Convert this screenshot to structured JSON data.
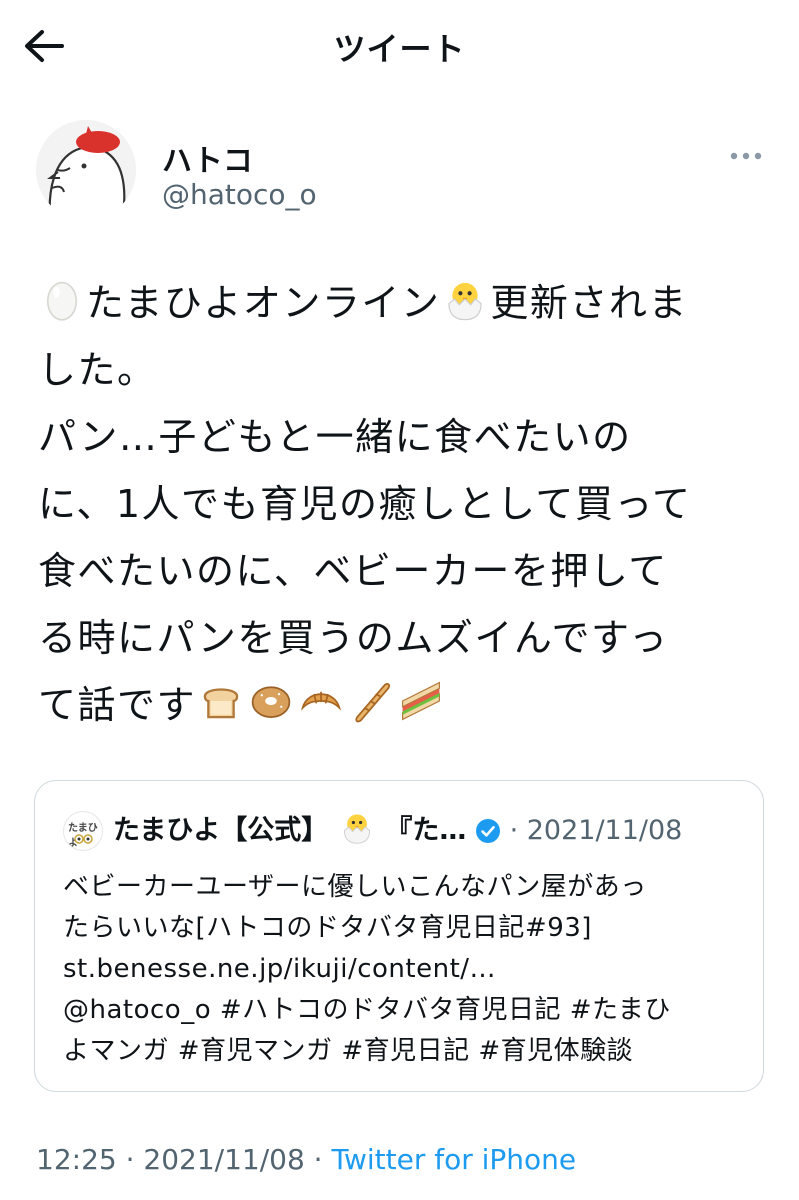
{
  "header": {
    "title": "ツイート",
    "back_icon": "arrow-left-icon"
  },
  "author": {
    "name": "ハトコ",
    "handle": "@hatoco_o",
    "more_icon": "ellipsis-icon"
  },
  "tweet": {
    "lines": [
      {
        "segments": [
          {
            "type": "emoji",
            "name": "egg-icon"
          },
          {
            "type": "text",
            "text": "たまひよオンライン"
          },
          {
            "type": "emoji",
            "name": "hatching-chick-icon"
          },
          {
            "type": "text",
            "text": "更新されま"
          }
        ]
      },
      {
        "segments": [
          {
            "type": "text",
            "text": "した。"
          }
        ]
      },
      {
        "segments": [
          {
            "type": "text",
            "text": "パン…子どもと一緒に食べたいの"
          }
        ]
      },
      {
        "segments": [
          {
            "type": "text",
            "text": "に、1人でも育児の癒しとして買って"
          }
        ]
      },
      {
        "segments": [
          {
            "type": "text",
            "text": "食べたいのに、ベビーカーを押して"
          }
        ]
      },
      {
        "segments": [
          {
            "type": "text",
            "text": "る時にパンを買うのムズイんですっ"
          }
        ]
      },
      {
        "segments": [
          {
            "type": "text",
            "text": "て話です"
          },
          {
            "type": "emoji",
            "name": "bread-icon"
          },
          {
            "type": "emoji",
            "name": "bagel-icon"
          },
          {
            "type": "emoji",
            "name": "croissant-icon"
          },
          {
            "type": "emoji",
            "name": "baguette-icon"
          },
          {
            "type": "emoji",
            "name": "sandwich-icon"
          }
        ]
      }
    ]
  },
  "quoted": {
    "avatar_text": "たまひよ",
    "name": "たまひよ【公式】",
    "name_rest": "『た…",
    "date": "· 2021/11/08",
    "lines": [
      "ベビーカーユーザーに優しいこんなパン屋があっ",
      "たらいいな[ハトコのドタバタ育児日記#93]",
      "st.benesse.ne.jp/ikuji/content/…",
      "@hatoco_o #ハトコのドタバタ育児日記 #たまひ",
      "よマンガ #育児マンガ #育児日記 #育児体験談"
    ]
  },
  "meta": {
    "time": "12:25 · 2021/11/08 · ",
    "source": "Twitter for iPhone"
  },
  "colors": {
    "text": "#0f1419",
    "secondary": "#536471",
    "link": "#1d9bf0",
    "border": "#cfd9de",
    "avatar_beret": "#d9312b"
  }
}
